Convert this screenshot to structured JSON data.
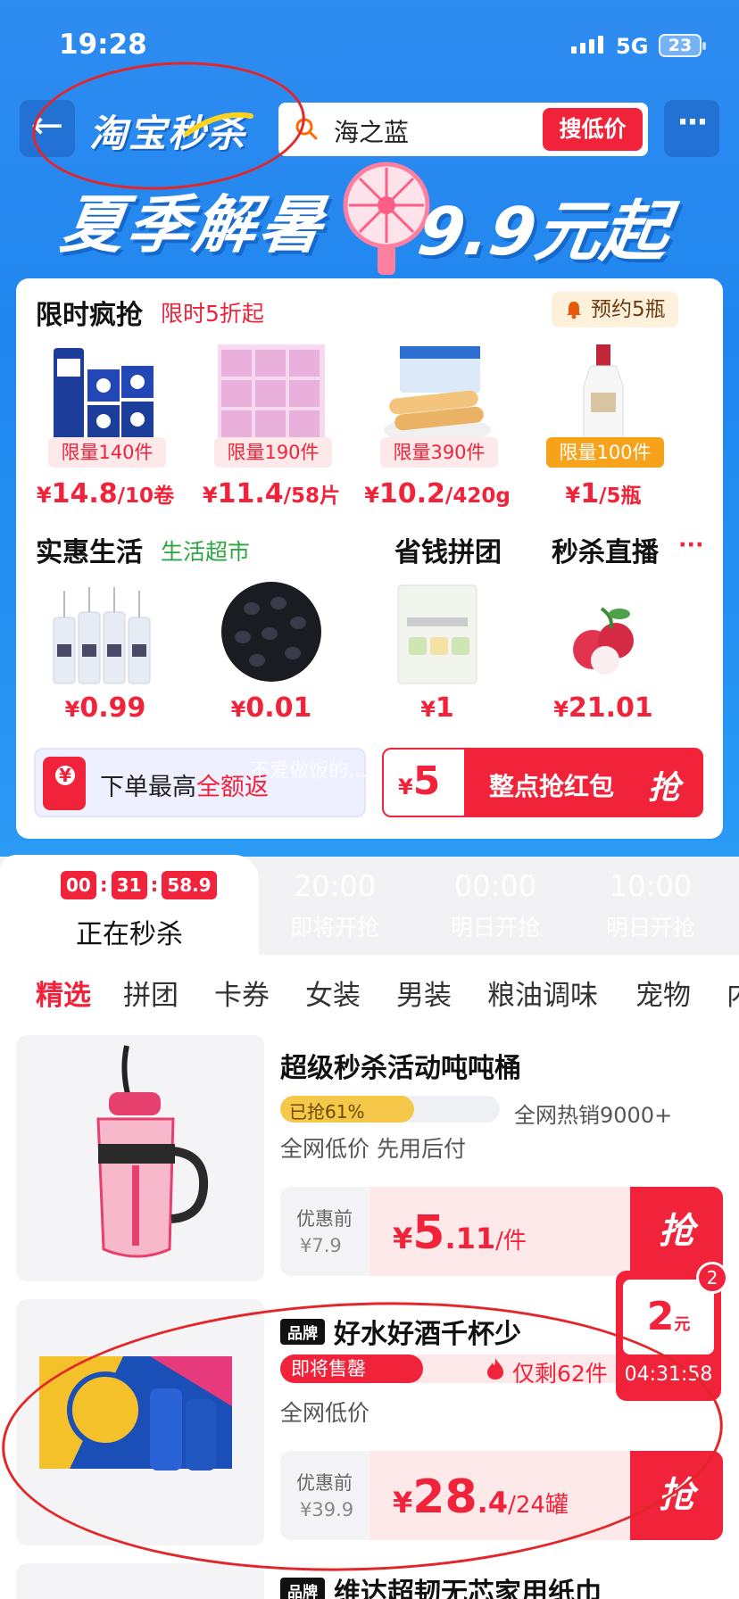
{
  "status": {
    "time": "19:28",
    "network": "5G",
    "battery": "23"
  },
  "nav": {
    "back": "←",
    "logo": "淘宝秒杀",
    "search_value": "海之蓝",
    "search_button": "搜低价",
    "more": "···"
  },
  "banner": {
    "title": "夏季解暑",
    "price": "9.9元起"
  },
  "flash": {
    "title": "限时疯抢",
    "subtitle": "限时5折起",
    "reserve": "预约5瓶",
    "items": [
      {
        "limit": "限量140件",
        "price": "14.8",
        "unit": "/10卷"
      },
      {
        "limit": "限量190件",
        "price": "11.4",
        "unit": "/58片"
      },
      {
        "limit": "限量390件",
        "price": "10.2",
        "unit": "/420g"
      },
      {
        "limit": "限量100件",
        "price": "1",
        "unit": "/5瓶"
      }
    ]
  },
  "sections": {
    "life": "实惠生活",
    "life_sub": "生活超市",
    "group": "省钱拼团",
    "live": "秒杀直播",
    "live_more": "···"
  },
  "row2": [
    {
      "price": "0.99"
    },
    {
      "price": "0.01"
    },
    {
      "price": "1"
    },
    {
      "price": "21.01"
    }
  ],
  "promo": {
    "text_a": "下单最高",
    "text_b": "全额返",
    "amount": "5",
    "label": "整点抢红包",
    "grab": "抢"
  },
  "currency": "¥",
  "watermark": "不爱做饭的…",
  "timebar": {
    "countdown": [
      "00",
      "31",
      "58.9"
    ],
    "active_label": "正在秒杀",
    "tabs": [
      {
        "time": "20:00",
        "status": "即将开抢"
      },
      {
        "time": "00:00",
        "status": "明日开抢"
      },
      {
        "time": "10:00",
        "status": "明日开抢"
      }
    ]
  },
  "categories": [
    "精选",
    "拼团",
    "卡券",
    "女装",
    "男装",
    "粮油调味",
    "宠物",
    "内"
  ],
  "products": [
    {
      "name": "超级秒杀活动吨吨桶",
      "progress_label": "已抢61%",
      "progress": 0.61,
      "hot": "全网热销9000+",
      "tags": "全网低价   先用后付",
      "was_label": "优惠前",
      "was": "¥7.9",
      "price_int": "5",
      "price_dec": ".11",
      "unit": "/件",
      "grab": "抢"
    },
    {
      "brand": "品牌",
      "name": "好水好酒千杯少",
      "sellout": "即将售罄",
      "remaining": "仅剩62件",
      "tags": "全网低价",
      "was_label": "优惠前",
      "was": "¥39.9",
      "price_int": "28",
      "price_dec": ".4",
      "unit": "/24罐",
      "grab": "抢"
    }
  ],
  "float_coupon": {
    "badge": "2",
    "value": "2",
    "unit": "元",
    "countdown": "04:31:58"
  },
  "peek": {
    "brand": "品牌",
    "name": "维达超韧无芯家用纸巾"
  },
  "colors": {
    "accent": "#f0233a",
    "banner": "#2a8ef0"
  }
}
